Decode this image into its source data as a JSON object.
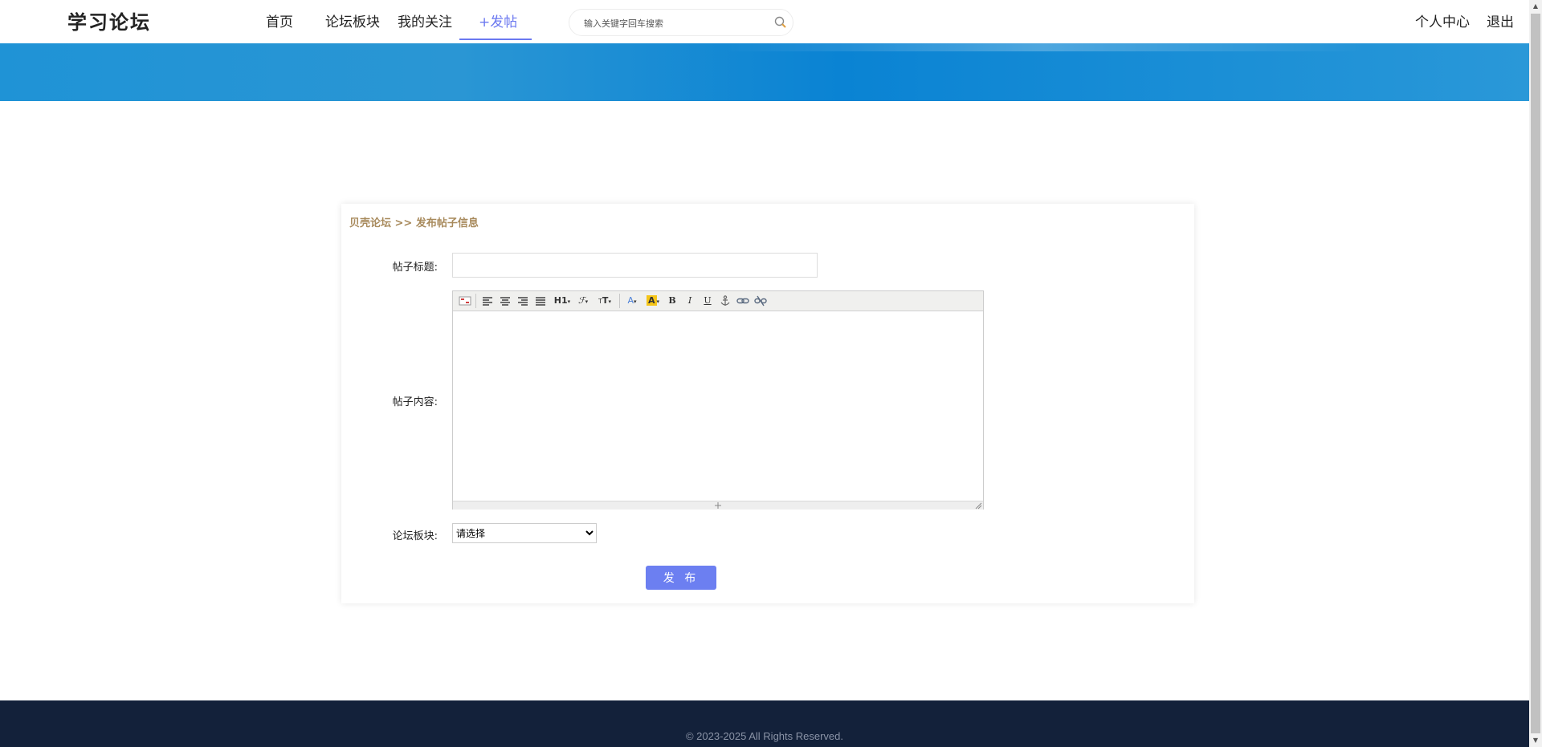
{
  "header": {
    "logo": "学习论坛",
    "nav": [
      {
        "label": "首页"
      },
      {
        "label": "论坛板块"
      },
      {
        "label": "我的关注"
      },
      {
        "label": "+发帖"
      }
    ],
    "search": {
      "placeholder": "输入关键字回车搜索",
      "value": ""
    },
    "user_center": "个人中心",
    "logout": "退出"
  },
  "form": {
    "breadcrumb": "贝壳论坛 >> 发布帖子信息",
    "title_label": "帖子标题:",
    "title_value": "",
    "content_label": "帖子内容:",
    "board_label": "论坛板块:",
    "board_selected": "请选择",
    "submit_label": "发 布"
  },
  "editor": {
    "toolbar": [
      "source-icon",
      "align-left-icon",
      "align-center-icon",
      "align-right-icon",
      "align-justify-icon",
      "heading-icon",
      "font-family-icon",
      "font-size-icon",
      "font-color-icon",
      "highlight-icon",
      "bold-icon",
      "italic-icon",
      "underline-icon",
      "anchor-icon",
      "link-icon",
      "unlink-icon"
    ],
    "heading_text": "H1",
    "bold_text": "B",
    "italic_text": "I",
    "underline_text": "U"
  },
  "footer": {
    "copyright": "© 2023-2025 All Rights Reserved."
  },
  "colors": {
    "accent": "#6c7ff1",
    "banner": "#1f93d6",
    "breadcrumb": "#a88a5c",
    "footer_bg": "#13213a"
  }
}
